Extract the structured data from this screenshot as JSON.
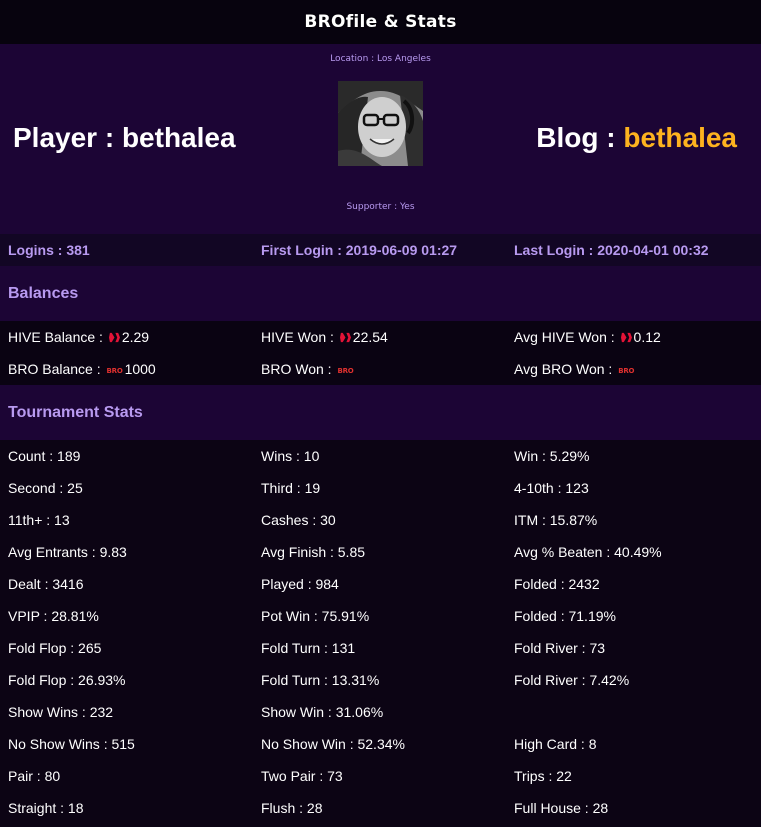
{
  "header": {
    "title": "BROfile & Stats"
  },
  "profile": {
    "location": "Location : Los Angeles",
    "player_label": "Player : bethalea",
    "blog_prefix": "Blog : ",
    "blog_name": "bethalea",
    "supporter": "Supporter : Yes",
    "blog_color": "#fdb31f"
  },
  "logins": {
    "count": "Logins : 381",
    "first": "First Login : 2019-06-09 01:27",
    "last": "Last Login : 2020-04-01 00:32"
  },
  "balances": {
    "heading": "Balances",
    "hive_balance_label": "HIVE Balance : ",
    "hive_balance_value": "2.29",
    "hive_won_label": "HIVE Won : ",
    "hive_won_value": "22.54",
    "avg_hive_won_label": "Avg HIVE Won : ",
    "avg_hive_won_value": "0.12",
    "bro_balance_label": "BRO Balance : ",
    "bro_balance_value": "1000",
    "bro_won_label": "BRO Won : ",
    "bro_won_value": "",
    "avg_bro_won_label": "Avg BRO Won : ",
    "avg_bro_won_value": "",
    "bro_icon_text": "BRO",
    "hive_icon": "hive-logo-icon",
    "bro_icon": "bro-token-icon"
  },
  "tournament": {
    "heading": "Tournament Stats",
    "rows": [
      [
        "Count : 189",
        "Wins : 10",
        "Win : 5.29%"
      ],
      [
        "Second : 25",
        "Third : 19",
        "4-10th : 123"
      ],
      [
        "11th+ : 13",
        "Cashes : 30",
        "ITM : 15.87%"
      ],
      [
        "Avg Entrants : 9.83",
        "Avg Finish : 5.85",
        "Avg % Beaten : 40.49%"
      ],
      [
        "Dealt : 3416",
        "Played : 984",
        "Folded : 2432"
      ],
      [
        "VPIP : 28.81%",
        "Pot Win : 75.91%",
        "Folded : 71.19%"
      ],
      [
        "Fold Flop : 265",
        "Fold Turn : 131",
        "Fold River : 73"
      ],
      [
        "Fold Flop : 26.93%",
        "Fold Turn : 13.31%",
        "Fold River : 7.42%"
      ],
      [
        "Show Wins : 232",
        "Show Win : 31.06%",
        ""
      ],
      [
        "No Show Wins : 515",
        "No Show Win : 52.34%",
        "High Card : 8"
      ],
      [
        "Pair : 80",
        "Two Pair : 73",
        "Trips : 22"
      ],
      [
        "Straight : 18",
        "Flush : 28",
        "Full House : 28"
      ]
    ]
  }
}
